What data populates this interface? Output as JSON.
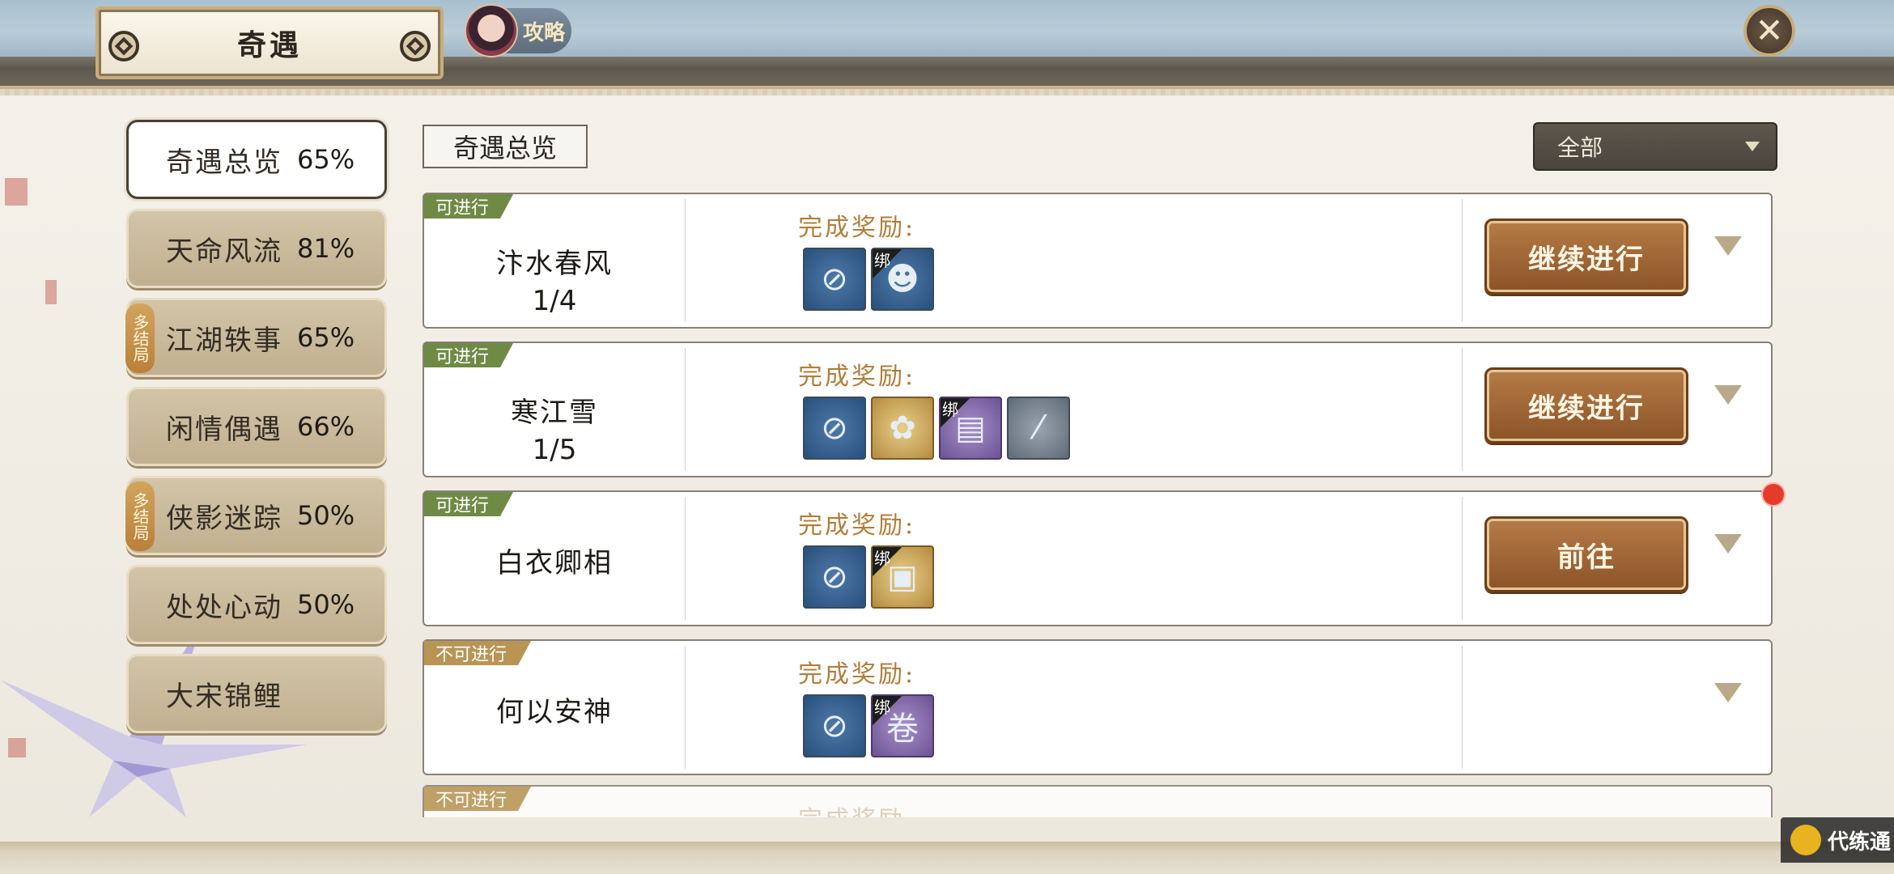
{
  "header": {
    "title": "奇遇",
    "guide_label": "攻略",
    "close_icon": "close-icon"
  },
  "nav": {
    "items": [
      {
        "name": "奇遇总览",
        "pct": "65%",
        "active": true,
        "multi": ""
      },
      {
        "name": "天命风流",
        "pct": "81%",
        "active": false,
        "multi": ""
      },
      {
        "name": "江湖轶事",
        "pct": "65%",
        "active": false,
        "multi": "多结局"
      },
      {
        "name": "闲情偶遇",
        "pct": "66%",
        "active": false,
        "multi": ""
      },
      {
        "name": "侠影迷踪",
        "pct": "50%",
        "active": false,
        "multi": "多结局"
      },
      {
        "name": "处处心动",
        "pct": "50%",
        "active": false,
        "multi": ""
      },
      {
        "name": "大宋锦鲤",
        "pct": "",
        "active": false,
        "multi": ""
      }
    ]
  },
  "main": {
    "section_title": "奇遇总览",
    "filter_value": "全部",
    "reward_label": "完成奖励:",
    "bind_label": "绑",
    "quests": [
      {
        "status": "可进行",
        "name": "汴水春风",
        "progress": "1/4",
        "button": "继续进行",
        "rewards": [
          {
            "icon": "medal-icon",
            "bound": false,
            "color": "blue"
          },
          {
            "icon": "figurines-icon",
            "bound": true,
            "color": "blue"
          }
        ]
      },
      {
        "status": "可进行",
        "name": "寒江雪",
        "progress": "1/5",
        "button": "继续进行",
        "rewards": [
          {
            "icon": "medal-icon",
            "bound": false,
            "color": "blue"
          },
          {
            "icon": "lotus-icon",
            "bound": false,
            "color": "gold"
          },
          {
            "icon": "scroll-book-icon",
            "bound": true,
            "color": "purple"
          },
          {
            "icon": "instrument-icon",
            "bound": false,
            "color": "grey"
          }
        ]
      },
      {
        "status": "可进行",
        "name": "白衣卿相",
        "progress": "",
        "button": "前往",
        "rewards": [
          {
            "icon": "medal-icon",
            "bound": false,
            "color": "blue"
          },
          {
            "icon": "treasure-chest-icon",
            "bound": true,
            "color": "gold"
          }
        ]
      },
      {
        "status": "不可进行",
        "name": "何以安神",
        "progress": "",
        "button": "",
        "rewards": [
          {
            "icon": "medal-icon",
            "bound": false,
            "color": "blue"
          },
          {
            "icon": "scroll-icon",
            "bound": true,
            "color": "purple"
          }
        ]
      }
    ],
    "partial_status": "不可进行"
  },
  "watermark": {
    "text": "代练通"
  }
}
